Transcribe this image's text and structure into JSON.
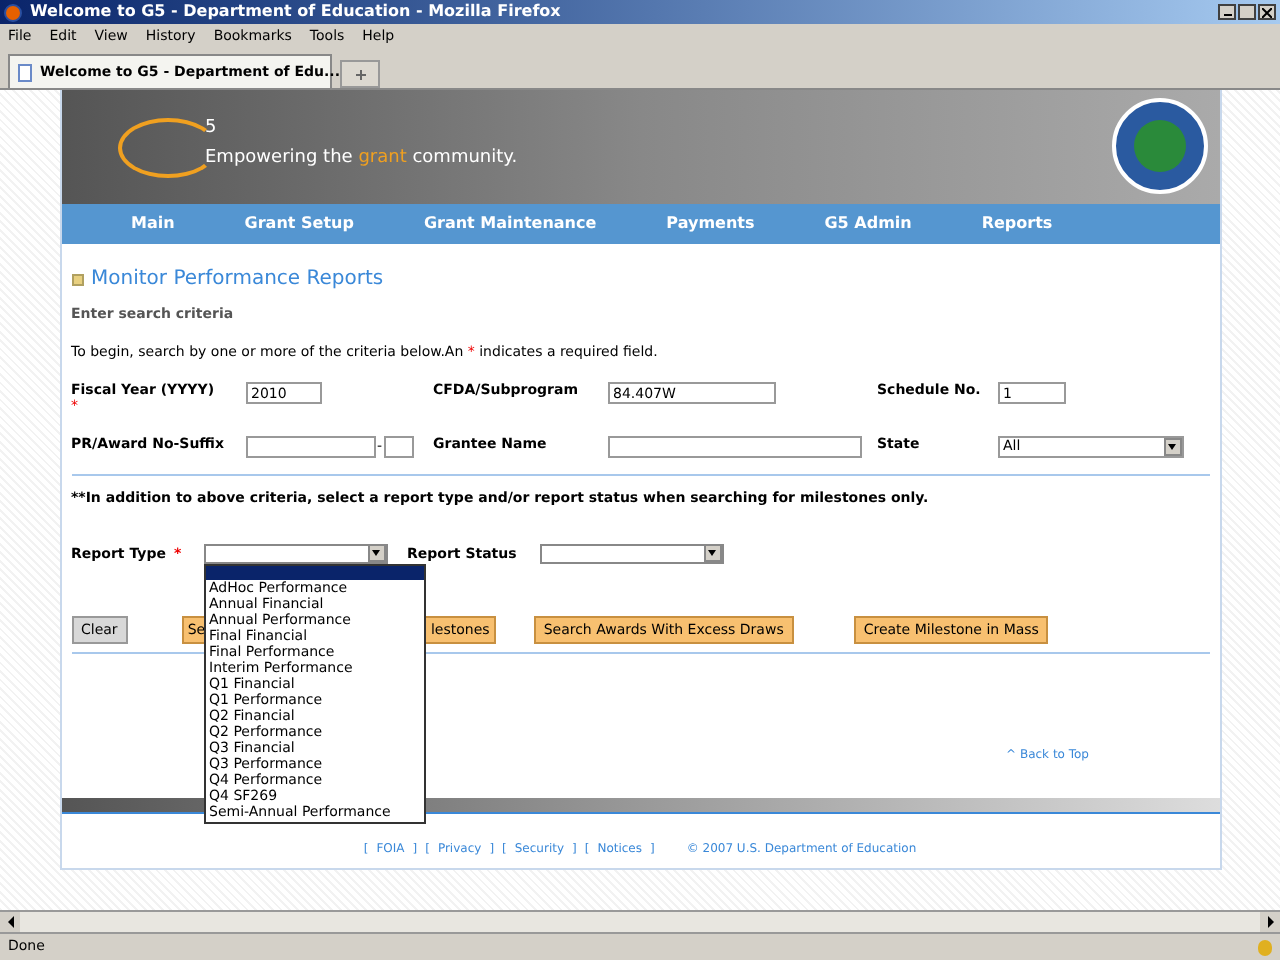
{
  "window": {
    "title": "Welcome to G5 - Department of Education - Mozilla Firefox"
  },
  "menu": [
    "File",
    "Edit",
    "View",
    "History",
    "Bookmarks",
    "Tools",
    "Help"
  ],
  "tab": {
    "label": "Welcome to G5 - Department of Edu...",
    "selected": true
  },
  "banner": {
    "logo_superscript": "5",
    "tagline_before": "Empowering the ",
    "tagline_highlight": "grant",
    "tagline_after": " community."
  },
  "nav": [
    "Main",
    "Grant Setup",
    "Grant Maintenance",
    "Payments",
    "G5 Admin",
    "Reports"
  ],
  "page_title": "Monitor Performance Reports",
  "section_heading": "Enter search criteria",
  "instruction": {
    "before": "To begin, search by one or more of the criteria below.An ",
    "mark": "*",
    "after": " indicates a required field."
  },
  "fields_row_1": [
    {
      "kind": "text",
      "label": "Fiscal Year (YYYY)",
      "required": true,
      "value": "2010"
    },
    {
      "kind": "text",
      "label": "CFDA/Subprogram",
      "required": false,
      "value": "84.407W"
    },
    {
      "kind": "text",
      "label": "Schedule No.",
      "required": false,
      "value": "1"
    }
  ],
  "fields_row_2": [
    {
      "kind": "pair",
      "label": "PR/Award No-Suffix",
      "required": false,
      "separator": "-"
    },
    {
      "kind": "text",
      "label": "Grantee Name",
      "required": false
    },
    {
      "kind": "select",
      "label": "State",
      "required": false,
      "value": "All"
    }
  ],
  "note": "**In addition to above criteria, select a report type and/or report status when searching for milestones only.",
  "report_fields": [
    {
      "label": "Report Type",
      "required": true,
      "open": true
    },
    {
      "label": "Report Status",
      "required": false,
      "open": false
    }
  ],
  "report_type_options": [
    "AdHoc Performance",
    "Annual Financial",
    "Annual Performance",
    "Final Financial",
    "Final Performance",
    "Interim Performance",
    "Q1 Financial",
    "Q1 Performance",
    "Q2 Financial",
    "Q2 Performance",
    "Q3 Financial",
    "Q3 Performance",
    "Q4 Performance",
    "Q4 SF269",
    "Semi-Annual Performance"
  ],
  "buttons": [
    {
      "kind": "grey",
      "label": "Clear"
    },
    {
      "kind": "orange",
      "label": "Se"
    },
    {
      "kind": "orange",
      "label": "lestones"
    },
    {
      "kind": "orange",
      "label": "Search Awards With Excess Draws"
    },
    {
      "kind": "orange",
      "label": "Create Milestone in Mass"
    }
  ],
  "back_to_top": "^ Back to Top",
  "footer": {
    "bracket_open": "[",
    "bracket_close": "]",
    "links": [
      "FOIA",
      "Privacy",
      "Security",
      "Notices"
    ]
  },
  "copyright": "© 2007 U.S. Department of Education",
  "status_bar": "Done"
}
